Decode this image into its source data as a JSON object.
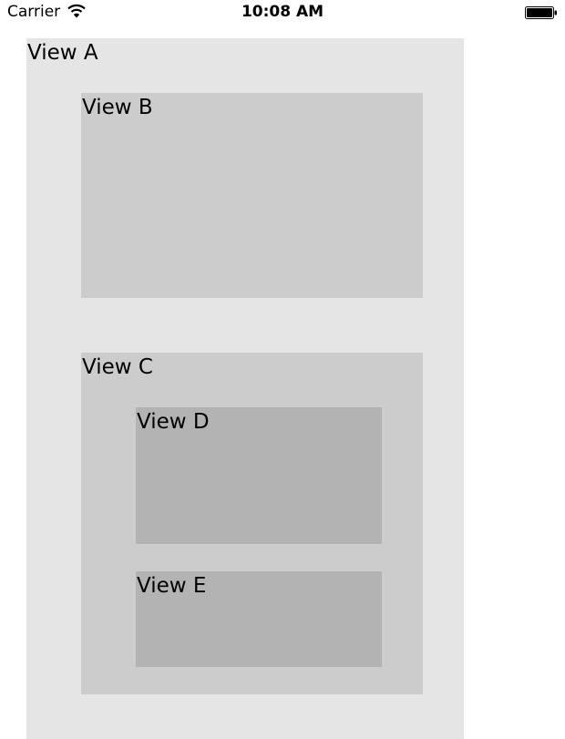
{
  "status_bar": {
    "carrier": "Carrier",
    "time": "10:08 AM",
    "wifi_icon": "wifi-icon",
    "battery_icon": "battery-icon"
  },
  "views": {
    "a": {
      "label": "View A",
      "color": "#e5e5e5"
    },
    "b": {
      "label": "View B",
      "color": "#cccccc"
    },
    "c": {
      "label": "View C",
      "color": "#cccccc"
    },
    "d": {
      "label": "View D",
      "color": "#b3b3b3"
    },
    "e": {
      "label": "View E",
      "color": "#b3b3b3"
    }
  }
}
